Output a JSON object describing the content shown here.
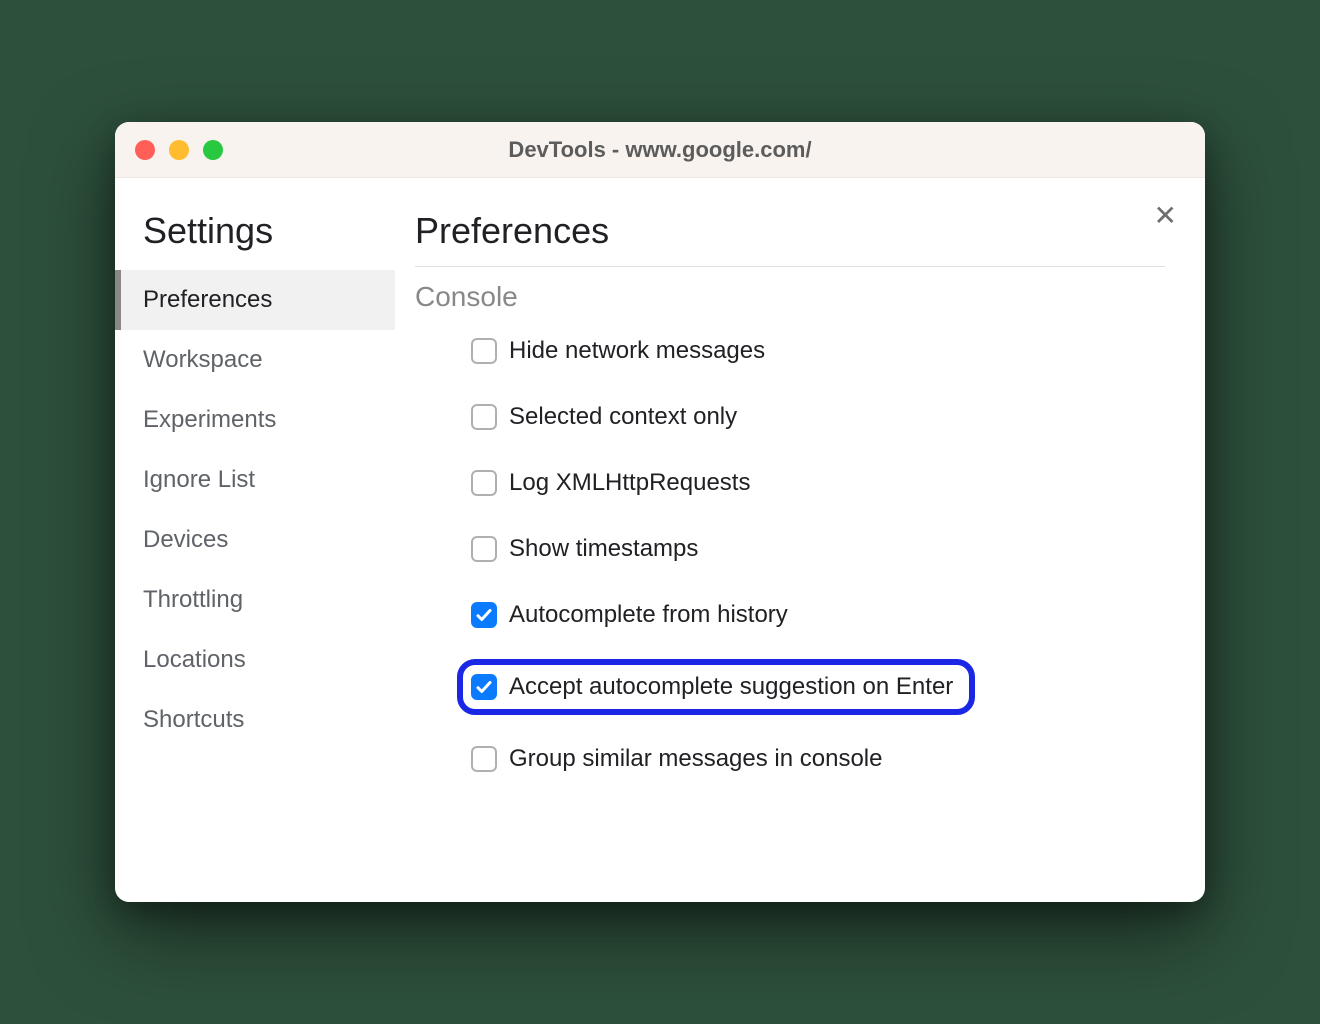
{
  "window": {
    "title": "DevTools - www.google.com/"
  },
  "sidebar": {
    "title": "Settings",
    "items": [
      {
        "label": "Preferences",
        "active": true
      },
      {
        "label": "Workspace",
        "active": false
      },
      {
        "label": "Experiments",
        "active": false
      },
      {
        "label": "Ignore List",
        "active": false
      },
      {
        "label": "Devices",
        "active": false
      },
      {
        "label": "Throttling",
        "active": false
      },
      {
        "label": "Locations",
        "active": false
      },
      {
        "label": "Shortcuts",
        "active": false
      }
    ]
  },
  "main": {
    "title": "Preferences",
    "section": "Console",
    "options": [
      {
        "label": "Hide network messages",
        "checked": false,
        "highlighted": false
      },
      {
        "label": "Selected context only",
        "checked": false,
        "highlighted": false
      },
      {
        "label": "Log XMLHttpRequests",
        "checked": false,
        "highlighted": false
      },
      {
        "label": "Show timestamps",
        "checked": false,
        "highlighted": false
      },
      {
        "label": "Autocomplete from history",
        "checked": true,
        "highlighted": false
      },
      {
        "label": "Accept autocomplete suggestion on Enter",
        "checked": true,
        "highlighted": true
      },
      {
        "label": "Group similar messages in console",
        "checked": false,
        "highlighted": false
      }
    ]
  },
  "colors": {
    "accent": "#0a7aff",
    "highlight_border": "#1a28e6"
  }
}
